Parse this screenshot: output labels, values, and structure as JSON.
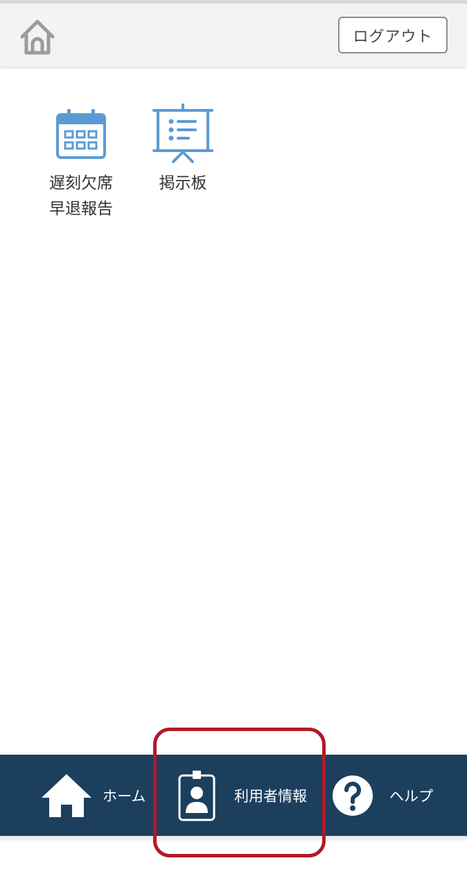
{
  "header": {
    "home_icon": "home-outline-icon",
    "logout_label": "ログアウト"
  },
  "menu": {
    "items": [
      {
        "label": "遅刻欠席\n早退報告",
        "icon": "calendar-icon"
      },
      {
        "label": "掲示板",
        "icon": "presentation-board-icon"
      }
    ]
  },
  "bottom_nav": {
    "items": [
      {
        "label": "ホーム",
        "icon": "home-filled-icon"
      },
      {
        "label": "利用者情報",
        "icon": "id-badge-icon"
      },
      {
        "label": "ヘルプ",
        "icon": "help-circle-icon"
      }
    ]
  },
  "colors": {
    "header_bg": "#f3f3f3",
    "icon_blue": "#5b9bd5",
    "nav_bg": "#1c3f5e",
    "highlight": "#b3192b"
  }
}
